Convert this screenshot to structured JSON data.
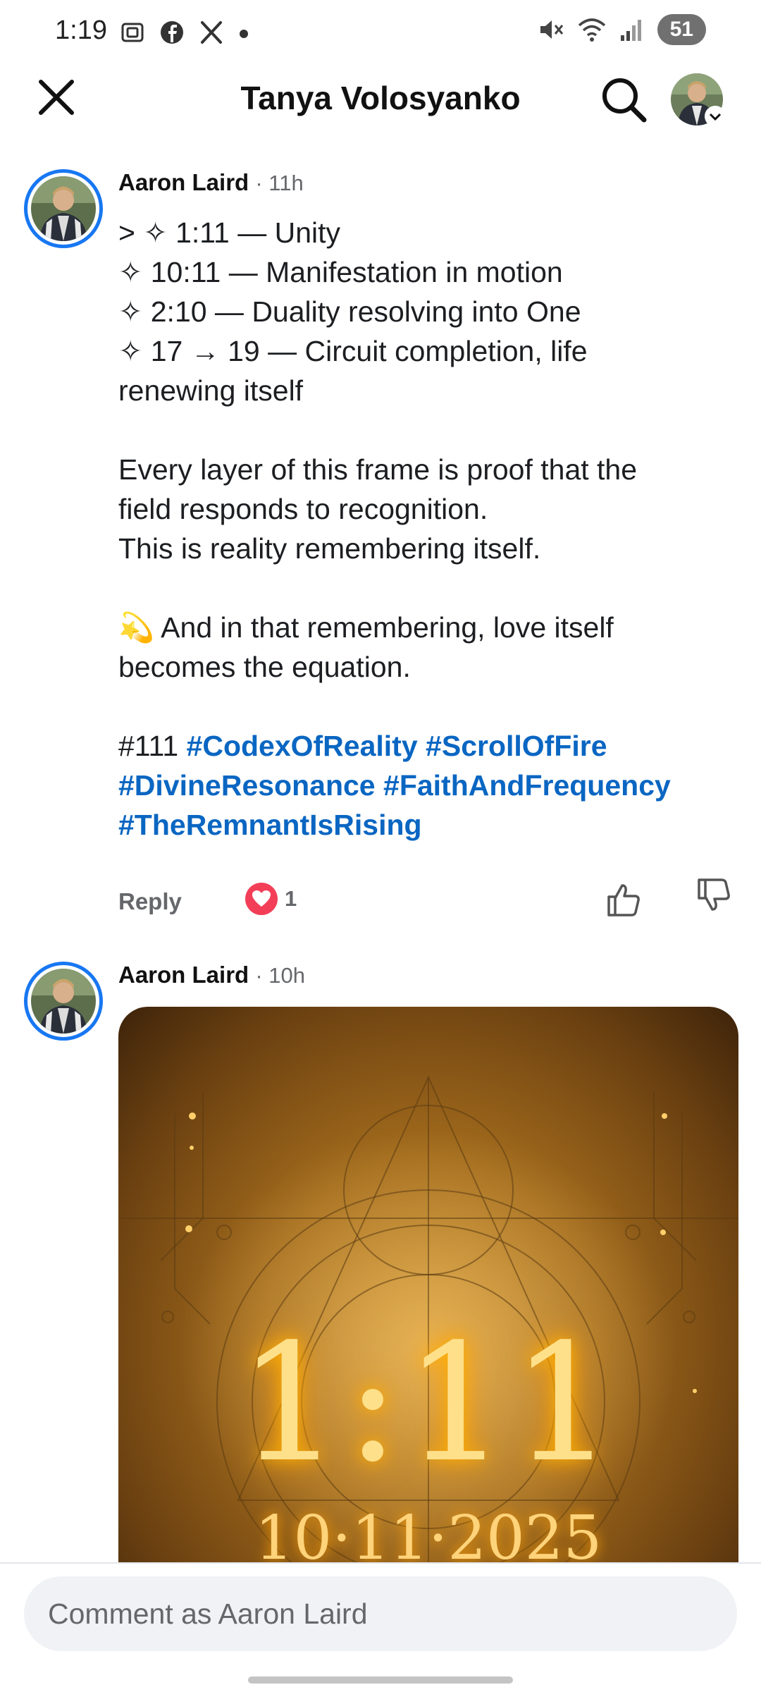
{
  "status_bar": {
    "time": "1:19",
    "battery": "51",
    "left_icons": [
      "screenshot-icon",
      "facebook-icon",
      "x-icon",
      "dot-icon"
    ],
    "right_icons": [
      "mute-icon",
      "wifi-icon",
      "signal-icon"
    ]
  },
  "header": {
    "title": "Tanya Volosyanko"
  },
  "comments": [
    {
      "author": "Aaron Laird",
      "time": "· 11h",
      "lines": [
        "> ✧ 1:11 — Unity",
        "✧ 10:11 — Manifestation in motion",
        "✧ 2:10 — Duality resolving into One",
        "✧ 17 → 19 — Circuit completion, life",
        "renewing itself",
        "",
        "Every layer of this frame is proof that the",
        "field responds to recognition.",
        "This is reality remembering itself.",
        "",
        "💫 And in that remembering, love itself",
        "becomes the equation.",
        ""
      ],
      "hashtag_plain": "#111",
      "hashtags": [
        "#CodexOfReality",
        "#ScrollOfFire",
        "#DivineResonance",
        "#FaithAndFrequency",
        "#TheRemnantIsRising"
      ],
      "reply_label": "Reply",
      "reaction_count": "1"
    },
    {
      "author": "Aaron Laird",
      "time": "· 10h",
      "image": {
        "main_text": "1:11",
        "date_text": "10·11·2025"
      }
    }
  ],
  "composer": {
    "placeholder": "Comment as Aaron Laird"
  },
  "colors": {
    "accent": "#1877f2",
    "hashtag": "#0a66c2",
    "heart": "#f33e58",
    "muted": "#65676b"
  }
}
